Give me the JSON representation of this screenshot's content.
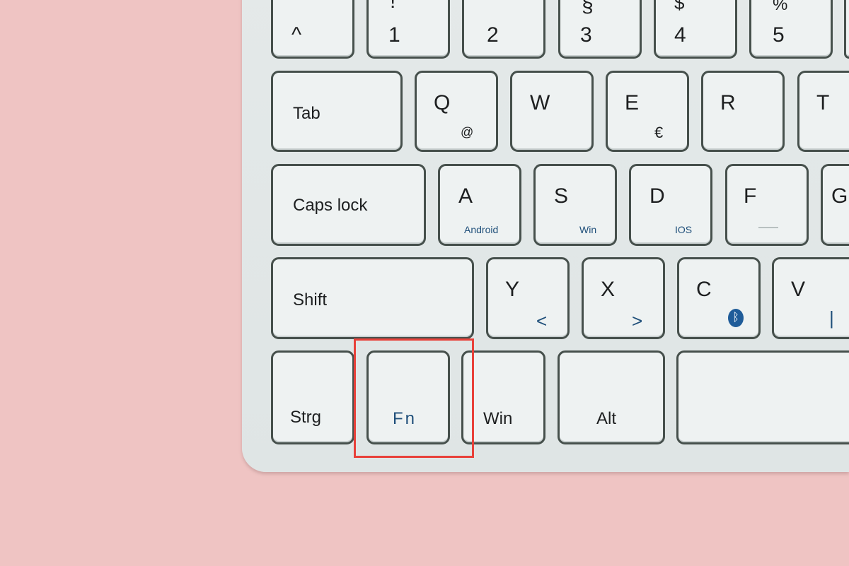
{
  "row0": {
    "k0_top": "°",
    "k0": "^",
    "k1_top": "!",
    "k1": "1",
    "k2_top": "\"",
    "k2": "2",
    "k3_top": "§",
    "k3": "3",
    "k4_top": "$",
    "k4": "4",
    "k5_top": "%",
    "k5": "5"
  },
  "row1": {
    "tab": "Tab",
    "q": "Q",
    "q_sub": "@",
    "w": "W",
    "e": "E",
    "e_sub": "€",
    "r": "R",
    "t": "T"
  },
  "row2": {
    "caps": "Caps lock",
    "a": "A",
    "a_sub": "Android",
    "s": "S",
    "s_sub": "Win",
    "d": "D",
    "d_sub": "IOS",
    "f": "F",
    "g": "G"
  },
  "row3": {
    "shift": "Shift",
    "y": "Y",
    "y_sub": "<",
    "x": "X",
    "x_sub": ">",
    "c": "C",
    "c_icon": "bluetooth-icon",
    "v": "V",
    "v_sub": "|"
  },
  "row4": {
    "strg": "Strg",
    "fn": "Fn",
    "win": "Win",
    "alt": "Alt"
  },
  "highlight": {
    "target": "Fn",
    "color": "#e8413a"
  },
  "colors": {
    "background": "#efc4c3",
    "keyboard": "#e3e8e8",
    "key": "#eef2f2",
    "legend_blue": "#1f4f7a"
  }
}
